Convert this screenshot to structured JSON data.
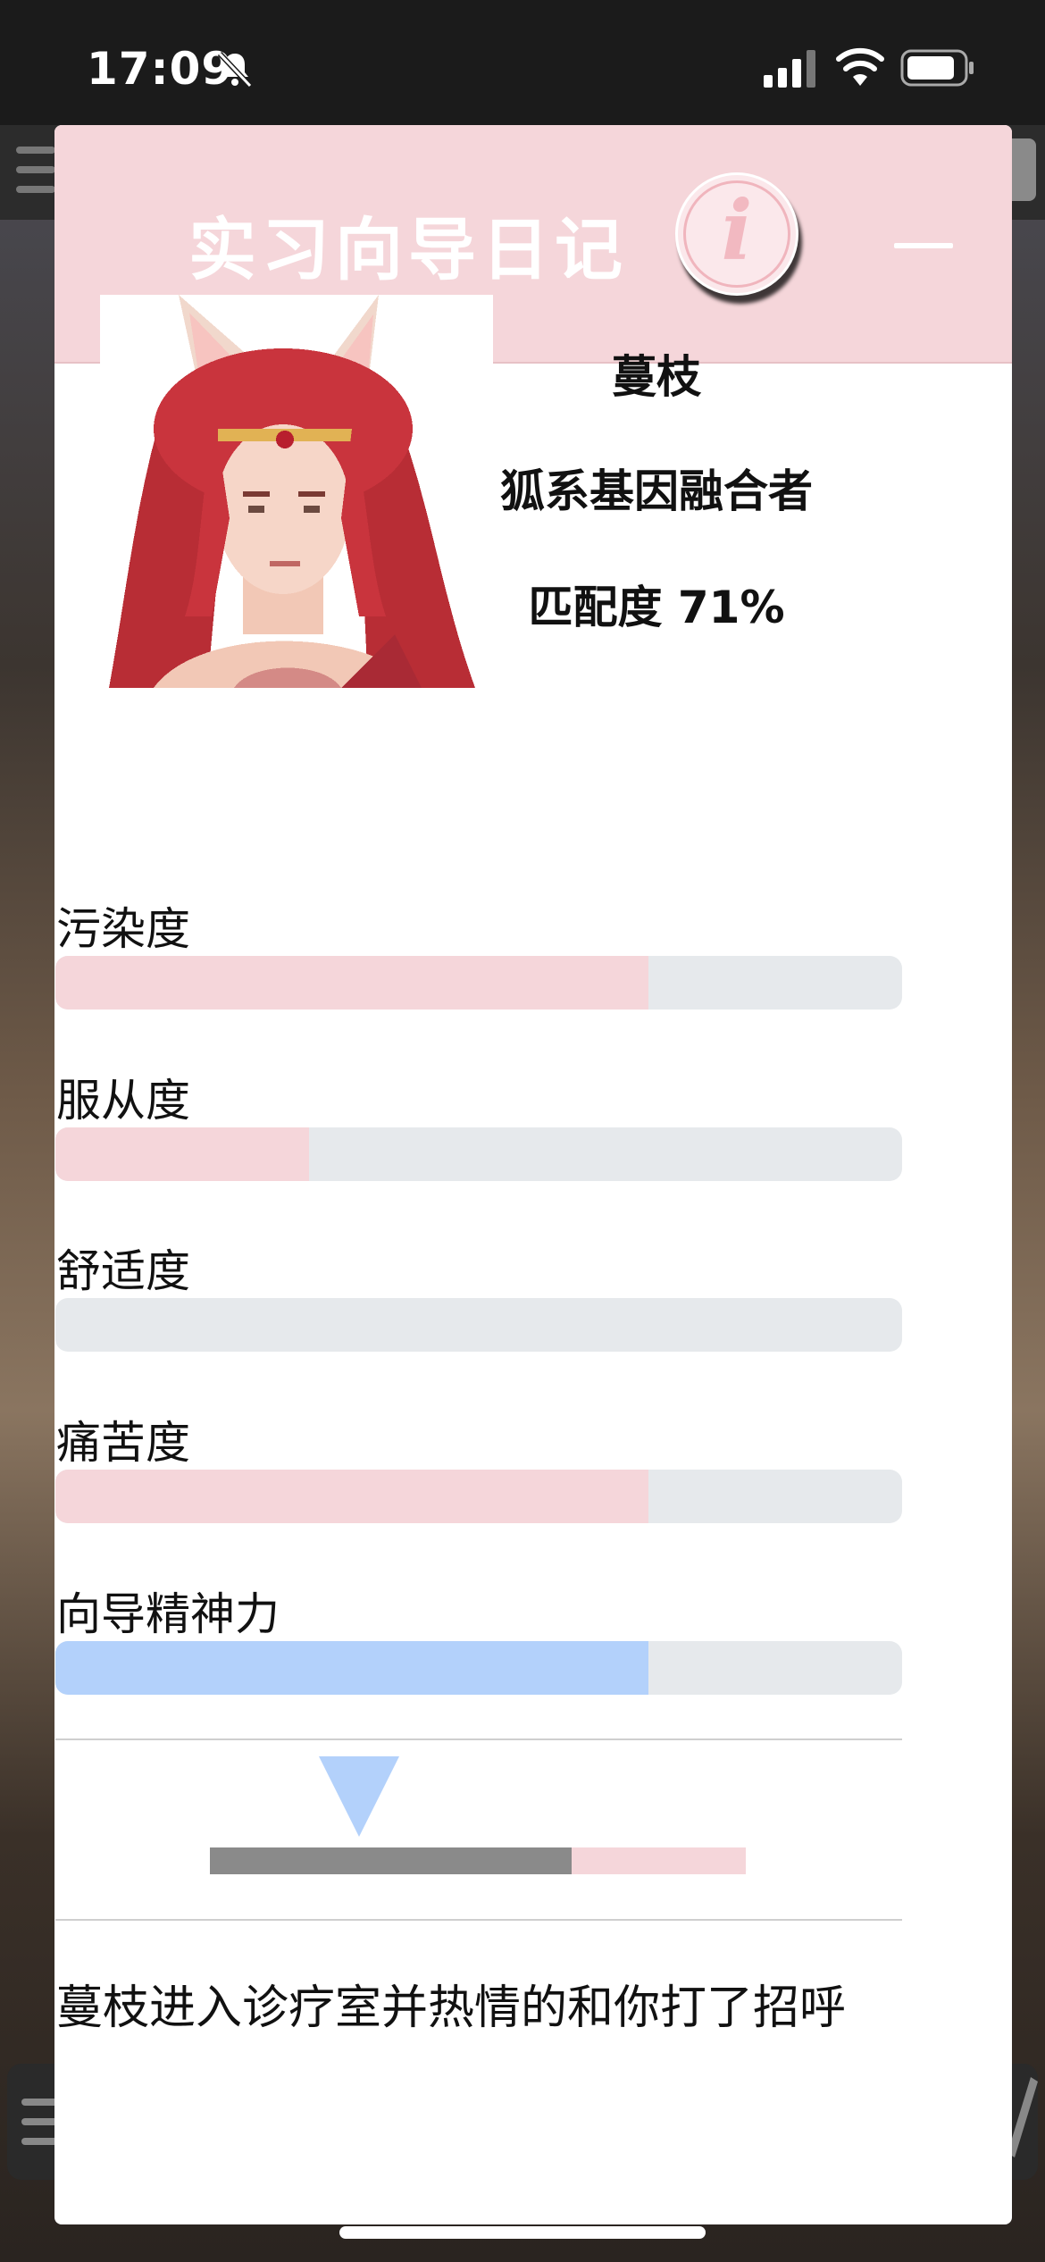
{
  "status_bar": {
    "time": "17:09"
  },
  "dialog": {
    "title": "实习向导日记",
    "info_icon": "i",
    "minimize_icon": "minimize-dash"
  },
  "character": {
    "name": "蔓枝",
    "type": "狐系基因融合者",
    "match": "匹配度 71%",
    "portrait": "pixel-art-fox-eared-red-haired-character"
  },
  "stats": [
    {
      "label": "污染度",
      "value": 0.7,
      "color": "#f5d6da"
    },
    {
      "label": "服从度",
      "value": 0.3,
      "color": "#f5d6da"
    },
    {
      "label": "舒适度",
      "value": 0.0,
      "color": "#f5d6da"
    },
    {
      "label": "痛苦度",
      "value": 0.7,
      "color": "#f5d6da"
    },
    {
      "label": "向导精神力",
      "value": 0.7,
      "color": "#b3d1fb"
    }
  ],
  "indicator": {
    "icon": "triangle-down-icon",
    "color": "#b3d1fb"
  },
  "progress": {
    "value": 0.675,
    "fill_color": "#8a8a8a",
    "track_color": "#f5d6da"
  },
  "message": "蔓枝进入诊疗室并热情的和你打了招呼"
}
